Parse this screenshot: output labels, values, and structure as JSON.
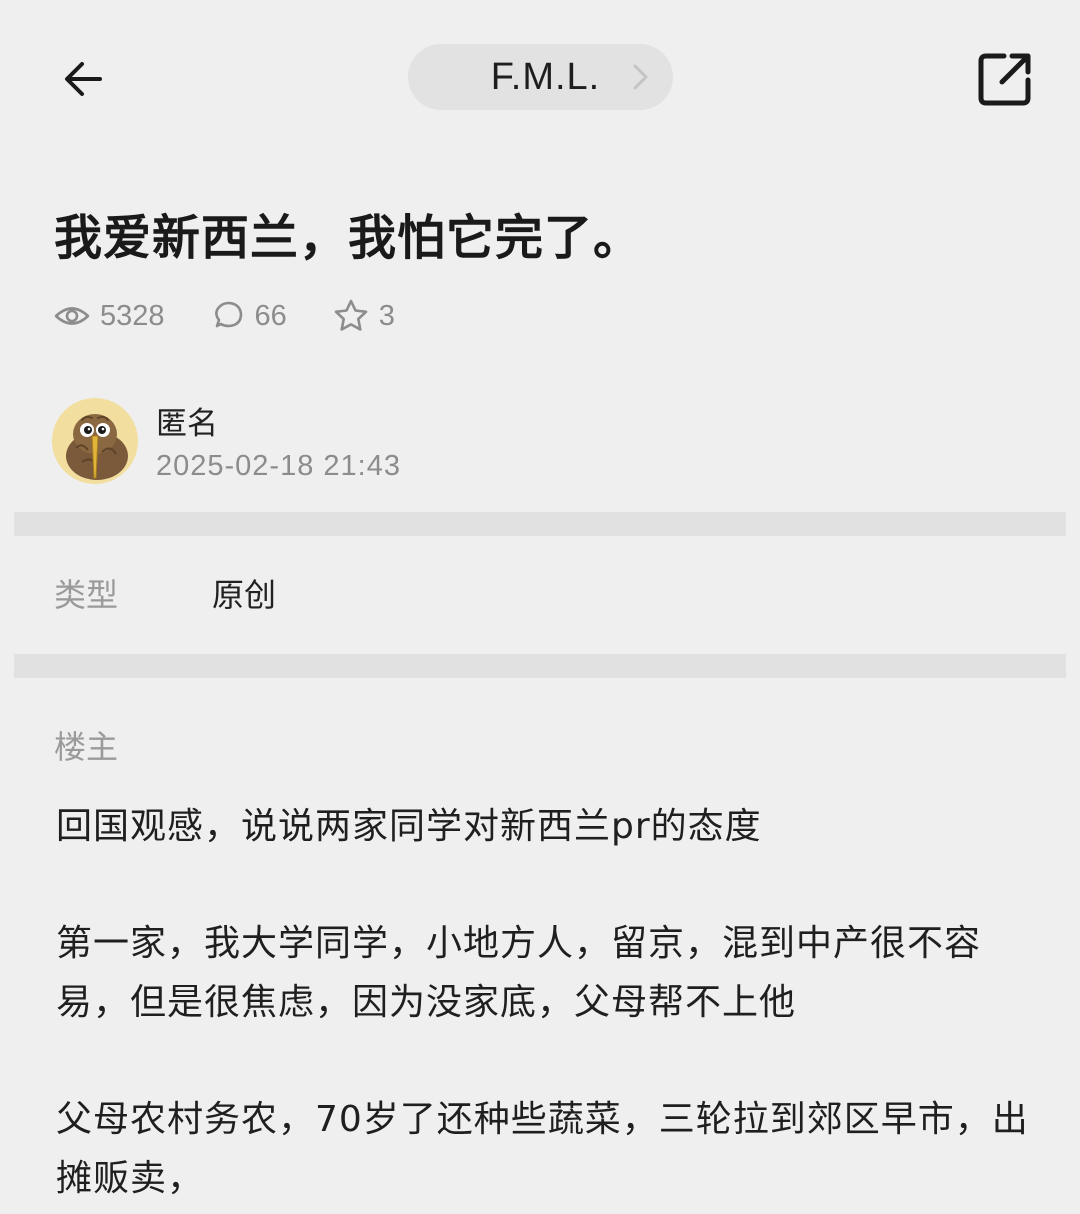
{
  "header": {
    "forum_name": "F.M.L."
  },
  "post": {
    "title": "我爱新西兰，我怕它完了。",
    "stats": {
      "views": "5328",
      "comments": "66",
      "favorites": "3"
    },
    "author": {
      "name": "匿名",
      "timestamp": "2025-02-18 21:43"
    },
    "type_label": "类型",
    "type_value": "原创",
    "op_label": "楼主",
    "paragraphs": [
      "回国观感，说说两家同学对新西兰pr的态度",
      "第一家，我大学同学，小地方人，留京，混到中产很不容易，但是很焦虑，因为没家底，父母帮不上他",
      "父母农村务农，70岁了还种些蔬菜，三轮拉到郊区早市，出摊贩卖，"
    ]
  },
  "icons": {
    "back": "arrow-left-icon",
    "chevron": "chevron-right-icon",
    "share": "external-share-icon",
    "views": "eye-icon",
    "comments": "chat-bubble-icon",
    "favorites": "star-icon"
  },
  "colors": {
    "background": "#efefef",
    "pill": "#e2e2e2",
    "divider": "#e1e1e1",
    "muted_text": "#8c8c8c"
  }
}
